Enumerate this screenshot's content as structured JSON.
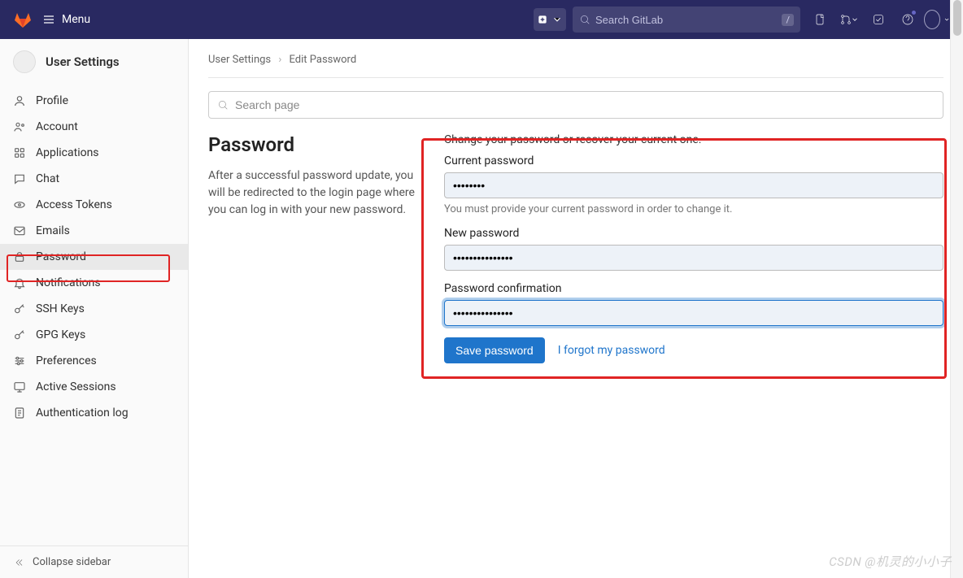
{
  "topbar": {
    "menu_label": "Menu",
    "search_placeholder": "Search GitLab",
    "search_kbd": "/"
  },
  "sidebar": {
    "title": "User Settings",
    "items": [
      {
        "label": "Profile",
        "icon": "profile-icon"
      },
      {
        "label": "Account",
        "icon": "account-icon"
      },
      {
        "label": "Applications",
        "icon": "applications-icon"
      },
      {
        "label": "Chat",
        "icon": "chat-icon"
      },
      {
        "label": "Access Tokens",
        "icon": "access-tokens-icon"
      },
      {
        "label": "Emails",
        "icon": "emails-icon"
      },
      {
        "label": "Password",
        "icon": "password-icon"
      },
      {
        "label": "Notifications",
        "icon": "notifications-icon"
      },
      {
        "label": "SSH Keys",
        "icon": "ssh-keys-icon"
      },
      {
        "label": "GPG Keys",
        "icon": "gpg-keys-icon"
      },
      {
        "label": "Preferences",
        "icon": "preferences-icon"
      },
      {
        "label": "Active Sessions",
        "icon": "active-sessions-icon"
      },
      {
        "label": "Authentication log",
        "icon": "auth-log-icon"
      }
    ],
    "collapse_label": "Collapse sidebar"
  },
  "breadcrumbs": {
    "root": "User Settings",
    "current": "Edit Password"
  },
  "page_search_placeholder": "Search page",
  "page": {
    "title": "Password",
    "description": "After a successful password update, you will be redirected to the login page where you can log in with your new password."
  },
  "form": {
    "intro": "Change your password or recover your current one.",
    "current_password_label": "Current password",
    "current_password_value": "••••••••",
    "current_password_hint": "You must provide your current password in order to change it.",
    "new_password_label": "New password",
    "new_password_value": "•••••••••••••••",
    "confirm_label": "Password confirmation",
    "confirm_value": "•••••••••••••••",
    "save_label": "Save password",
    "forgot_label": "I forgot my password"
  },
  "watermark": "CSDN @机灵的小小子"
}
